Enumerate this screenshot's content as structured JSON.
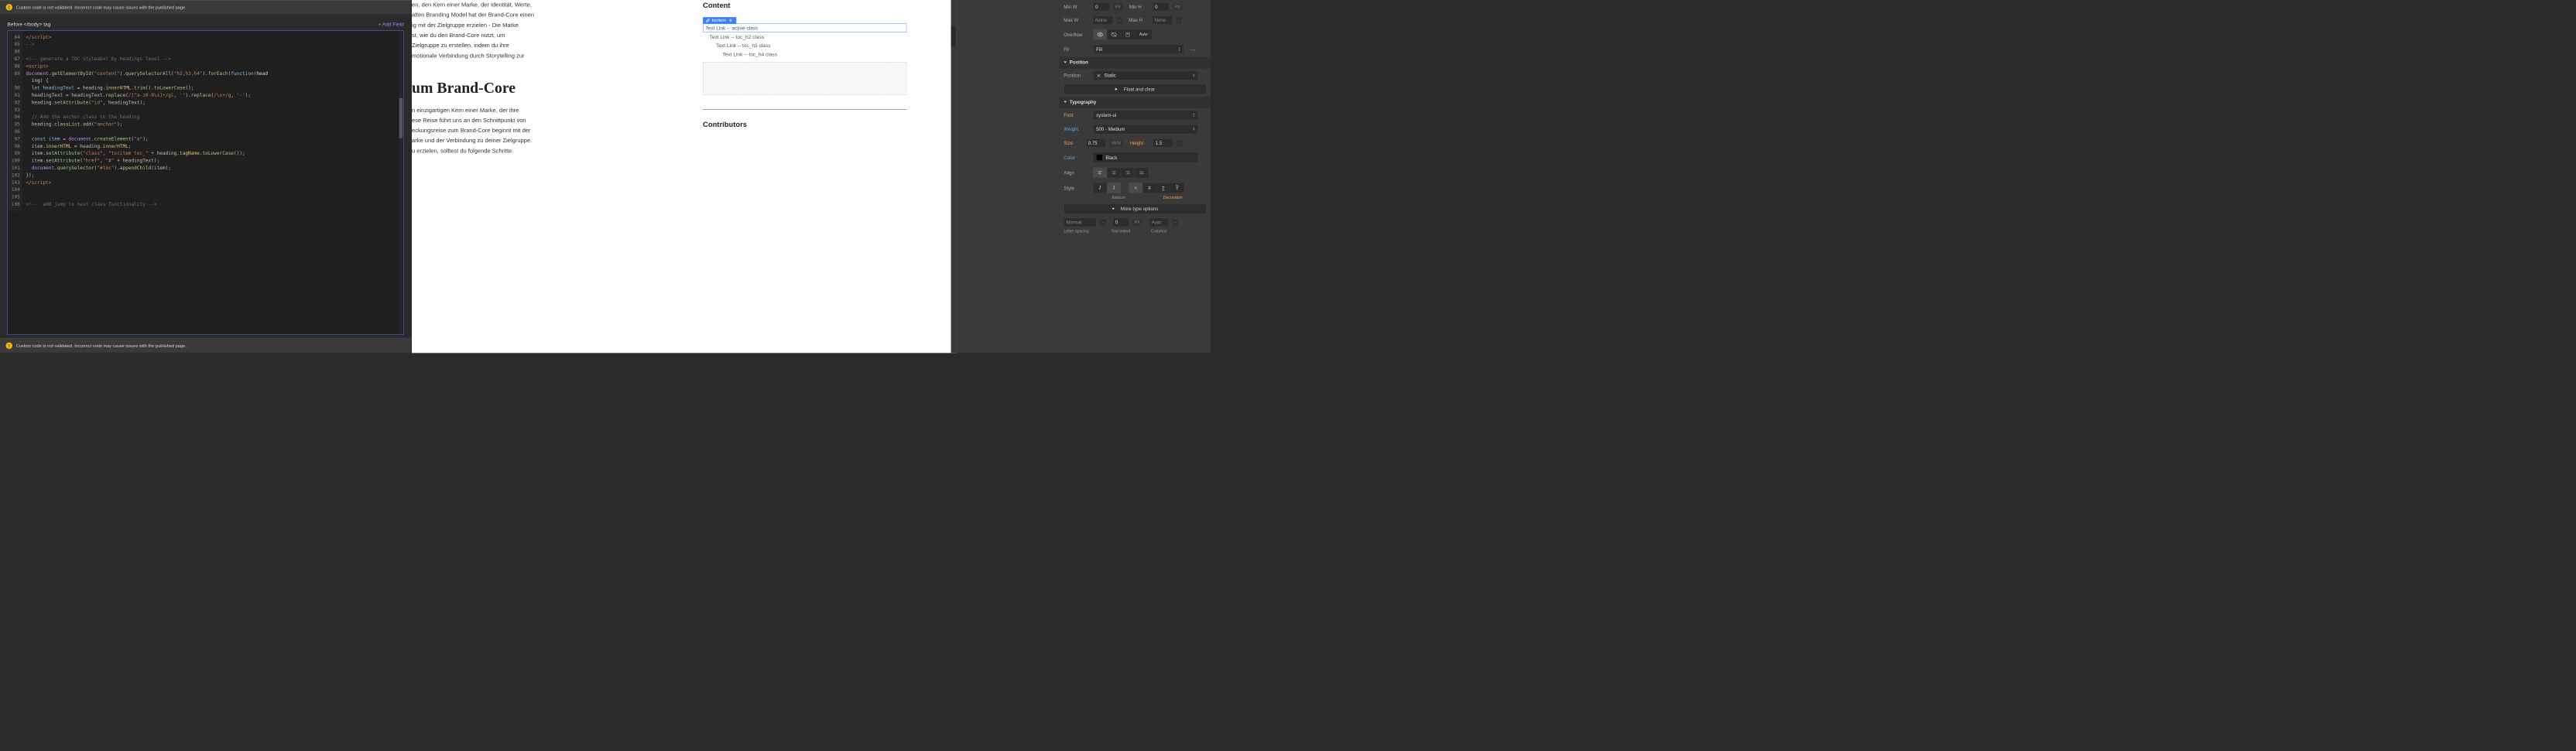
{
  "warning": {
    "text": "Custom code is not validated. Incorrect code may cause issues with the published page."
  },
  "header": {
    "title": "Before </body> tag",
    "add_field": "+ Add Field"
  },
  "code": {
    "lines": [
      {
        "n": 84,
        "html": "<span class='tok-tag'>&lt;/script&gt;</span>"
      },
      {
        "n": 85,
        "html": "<span class='tok-cmt'>--&gt;</span>"
      },
      {
        "n": 86,
        "html": ""
      },
      {
        "n": 87,
        "html": "<span class='tok-cmt'>&lt;!-- generate a TOC styleabel by headings level --&gt;</span>"
      },
      {
        "n": 88,
        "html": "<span class='tok-tag'>&lt;script&gt;</span>"
      },
      {
        "n": 89,
        "html": "<span class='tok-obj'>document</span>.<span class='tok-fn'>getElementById</span>(<span class='tok-str'>\"content\"</span>).<span class='tok-fn'>querySelectorAll</span>(<span class='tok-str'>\"h2,h3,h4\"</span>).<span class='tok-fn'>forEach</span>(<span class='tok-kw'>function</span>(<span class='tok-id'>head</span>"
      },
      {
        "n": "",
        "html": "  <span class='tok-id'>ing</span>) {"
      },
      {
        "n": 90,
        "html": "  <span class='tok-kw'>let</span> <span class='tok-var'>headingText</span> = heading.<span class='tok-prop'>innerHTML</span>.<span class='tok-fn'>trim</span>().<span class='tok-fn'>toLowerCase</span>();"
      },
      {
        "n": 91,
        "html": "  headingText = headingText.<span class='tok-fn'>replace</span>(<span class='tok-str'>/[^a-z0-9\\s]+/gi</span>, <span class='tok-str'>''</span>).<span class='tok-fn'>replace</span>(<span class='tok-str'>/\\s+/g</span>, <span class='tok-str'>'-'</span>);"
      },
      {
        "n": 92,
        "html": "  heading.<span class='tok-fn'>setAttribute</span>(<span class='tok-str'>\"id\"</span>, headingText);"
      },
      {
        "n": 93,
        "html": ""
      },
      {
        "n": 94,
        "html": "  <span class='tok-cmt'>// Add the anchor class to the heading</span>"
      },
      {
        "n": 95,
        "html": "  heading.<span class='tok-prop'>classList</span>.<span class='tok-fn'>add</span>(<span class='tok-str'>\"anchor\"</span>);"
      },
      {
        "n": 96,
        "html": ""
      },
      {
        "n": 97,
        "html": "  <span class='tok-kw'>const</span> <span class='tok-var'>item</span> = <span class='tok-obj'>document</span>.<span class='tok-fn'>createElement</span>(<span class='tok-str'>\"a\"</span>);"
      },
      {
        "n": 98,
        "html": "  item.<span class='tok-prop'>innerHTML</span> = heading.<span class='tok-prop'>innerHTML</span>;"
      },
      {
        "n": 99,
        "html": "  item.<span class='tok-fn'>setAttribute</span>(<span class='tok-str'>\"class\"</span>, <span class='tok-str'>\"tocitem toc_\"</span> + heading.<span class='tok-prop'>tagName</span>.<span class='tok-fn'>toLowerCase</span>());"
      },
      {
        "n": 100,
        "html": "  item.<span class='tok-fn'>setAttribute</span>(<span class='tok-str'>\"href\"</span>, <span class='tok-str'>\"#\"</span> + headingText);"
      },
      {
        "n": 101,
        "html": "  <span class='tok-obj'>document</span>.<span class='tok-fn'>querySelector</span>(<span class='tok-str'>\"#toc\"</span>).<span class='tok-fn'>appendChild</span>(item);"
      },
      {
        "n": 102,
        "html": "});"
      },
      {
        "n": 103,
        "html": "<span class='tok-tag'>&lt;/script&gt;</span>"
      },
      {
        "n": 104,
        "html": ""
      },
      {
        "n": 105,
        "html": ""
      },
      {
        "n": 106,
        "html": "<span class='tok-cmt'>&lt;!--  add jump to next class functionality --&gt;</span>"
      }
    ]
  },
  "article": {
    "p1_lines": [
      "en, den Kern einer Marke, der Identität, Werte,",
      "alten Branding Model hat der Brand-Core einen",
      "ig mit der Zielgruppe erzielen - Die Marke",
      "st, wie du den Brand-Core nutzt, um",
      "Zielgruppe zu erstellen, indem du ihre",
      "motionale Verbindung durch Storytelling zur"
    ],
    "heading": "um Brand-Core",
    "p2_lines": [
      "n einzigartigen Kern einer Marke, der ihre",
      "ese Reise führt uns an den Schnittpunkt von",
      "eckungsreise zum Brand-Core beginnt mit der",
      "arke und der Verbindung zu deiner Zielgruppe.",
      "u erzielen, solltest du folgende Schritte"
    ]
  },
  "toc": {
    "heading": "Content",
    "badge": "tocitem",
    "items": [
      {
        "label": "Text Link -- active class",
        "indent": 0,
        "active": true
      },
      {
        "label": "Text Link -- toc_h2 class",
        "indent": 1,
        "active": false
      },
      {
        "label": "Text Link -- toc_h3 class",
        "indent": 2,
        "active": false
      },
      {
        "label": "Text Link -- toc_h4 class",
        "indent": 3,
        "active": false
      }
    ],
    "contributors": "Contributors"
  },
  "styles": {
    "minw": {
      "label": "Min W",
      "value": "0",
      "unit": "PX"
    },
    "minh": {
      "label": "Min H",
      "value": "0",
      "unit": "PX"
    },
    "maxw": {
      "label": "Max W",
      "value": "None"
    },
    "maxh": {
      "label": "Max H",
      "value": "None"
    },
    "overflow": {
      "label": "Overflow",
      "auto": "Auto"
    },
    "fit": {
      "label": "Fit",
      "value": "Fill"
    },
    "position_section": "Position",
    "position": {
      "label": "Position",
      "value": "Static"
    },
    "floatclear": "Float and clear",
    "typo_section": "Typography",
    "font": {
      "label": "Font",
      "value": "system-ui"
    },
    "weight": {
      "label": "Weight",
      "value": "500 - Medium"
    },
    "size": {
      "label": "Size",
      "value": "0.75",
      "unit": "REM"
    },
    "height": {
      "label": "Height",
      "value": "1.5",
      "unit": "-"
    },
    "color": {
      "label": "Color",
      "value": "Black"
    },
    "align": {
      "label": "Align"
    },
    "style": {
      "label": "Style"
    },
    "sub_italic": "Italicize",
    "sub_deco": "Decoration",
    "more": "More type options",
    "letterspace_value": "Normal",
    "letterspace_unit": "-",
    "indent_value": "0",
    "indent_unit": "PX",
    "cols_value": "Auto",
    "cols_unit": "-",
    "letterspace_label": "Letter spacing",
    "indent_label": "Text indent",
    "cols_label": "Columns"
  }
}
